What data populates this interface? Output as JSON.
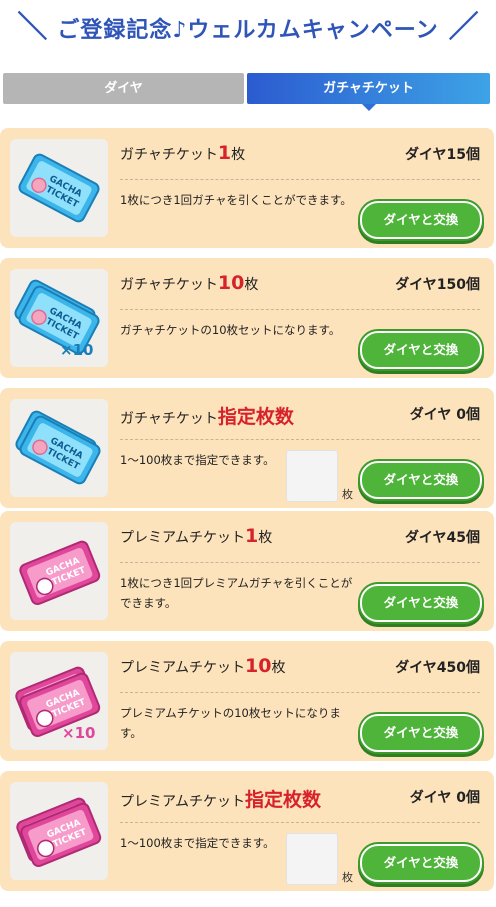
{
  "header": {
    "title": "ご登録記念♪ウェルカムキャンペーン"
  },
  "tabs": {
    "diamond": "ダイヤ",
    "ticket": "ガチャチケット"
  },
  "icons": {
    "ticket_text": "GACHA TICKET",
    "times10": "×10",
    "blue": "#3bb5ea",
    "pink": "#e0479b"
  },
  "colors": {
    "highlight": "#d6222a",
    "button": "#4fb43a",
    "card": "#fde3bc",
    "tab_active": "#2c5bd0"
  },
  "cards": [
    {
      "title_pre": "ガチャチケット",
      "title_hl": "1",
      "title_post": "枚",
      "price": "ダイヤ15個",
      "desc": "1枚につき1回ガチャを引くことができます。",
      "button": "ダイヤと交換"
    },
    {
      "title_pre": "ガチャチケット",
      "title_hl": "10",
      "title_post": "枚",
      "price": "ダイヤ150個",
      "desc": "ガチャチケットの10枚セットになります。",
      "button": "ダイヤと交換"
    },
    {
      "title_pre": "ガチャチケット",
      "title_hl": "指定枚数",
      "title_post": "",
      "price": "ダイヤ 0個",
      "desc": "1～100枚まで指定できます。",
      "unit": "枚",
      "button": "ダイヤと交換"
    },
    {
      "title_pre": "プレミアムチケット",
      "title_hl": "1",
      "title_post": "枚",
      "price": "ダイヤ45個",
      "desc": "1枚につき1回プレミアムガチャを引くことができます。",
      "button": "ダイヤと交換"
    },
    {
      "title_pre": "プレミアムチケット",
      "title_hl": "10",
      "title_post": "枚",
      "price": "ダイヤ450個",
      "desc": "プレミアムチケットの10枚セットになります。",
      "button": "ダイヤと交換"
    },
    {
      "title_pre": "プレミアムチケット",
      "title_hl": "指定枚数",
      "title_post": "",
      "price": "ダイヤ 0個",
      "desc": "1～100枚まで指定できます。",
      "unit": "枚",
      "button": "ダイヤと交換"
    }
  ]
}
